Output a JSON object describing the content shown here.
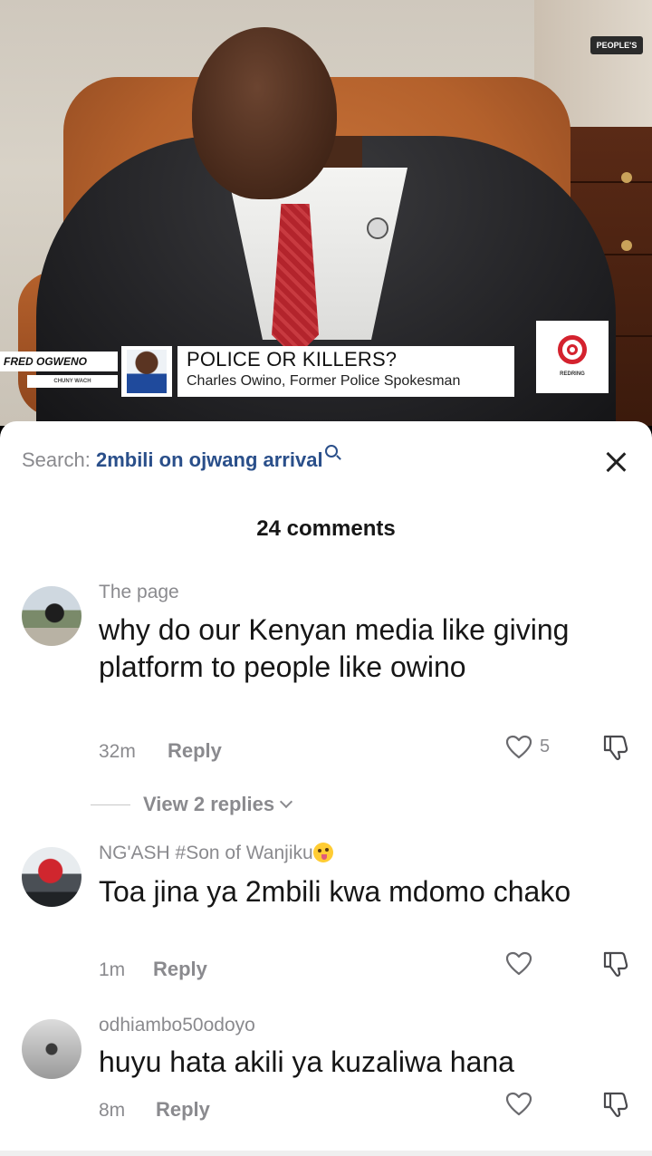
{
  "video": {
    "channel_logo": "PEOPLE'S",
    "anchor_name": "FRED OGWENO",
    "anchor_sub": "CHUNY WACH",
    "headline": "POLICE OR KILLERS?",
    "caption": "Charles Owino, Former Police Spokesman",
    "brand_logo_text": "REDRING"
  },
  "sheet": {
    "search_label": "Search:",
    "search_query": "2mbili on ojwang arrival",
    "comment_count": "24 comments",
    "comments": [
      {
        "user": "The page",
        "text": "why do our Kenyan media like giving platform to people like owino",
        "time": "32m",
        "reply": "Reply",
        "likes": "5",
        "view_replies": "View 2 replies"
      },
      {
        "user": "NG'ASH #Son of Wanjiku",
        "text": "Toa jina ya 2mbili kwa mdomo chako",
        "time": "1m",
        "reply": "Reply",
        "likes": ""
      },
      {
        "user": "odhiambo50odoyo",
        "text": "huyu hata akili ya kuzaliwa hana",
        "time": "8m",
        "reply": "Reply",
        "likes": ""
      }
    ]
  },
  "colors": {
    "link": "#2a4f8a",
    "muted": "#8a8a8e",
    "text": "#161616",
    "accent_red": "#d4222e"
  },
  "icons": [
    "search-icon",
    "close-icon",
    "heart-icon",
    "dislike-icon",
    "chevron-down-icon",
    "emoji-icon"
  ]
}
